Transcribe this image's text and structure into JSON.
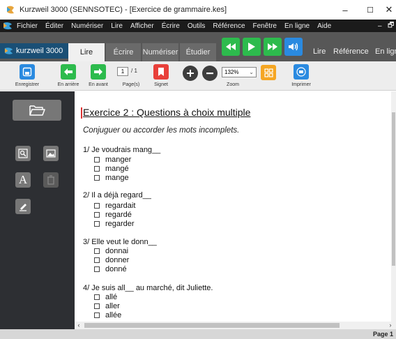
{
  "window": {
    "title": "Kurzweil 3000 (SENNSOTEC) - [Exercice de grammaire.kes]",
    "minimize": "–",
    "maximize": "☐",
    "close": "✕"
  },
  "menu": {
    "items": [
      "Fichier",
      "Éditer",
      "Numériser",
      "Lire",
      "Afficher",
      "Écrire",
      "Outils",
      "Référence",
      "Fenêtre",
      "En ligne",
      "Aide"
    ],
    "min_ctl": "–",
    "restore_ctl": "🗗"
  },
  "tabs": {
    "brand": "kurzweil 3000",
    "items": [
      "Lire",
      "Écrire",
      "Numériser",
      "Étudier"
    ],
    "active": "Lire",
    "right_items": [
      "Lire",
      "Référence",
      "En ligne"
    ]
  },
  "toolbar": {
    "save_label": "Enregistrer",
    "back_label": "En arrière",
    "forward_label": "En avant",
    "pages_label": "Page(s)",
    "bookmark_label": "Signet",
    "zoom_label": "Zoom",
    "print_label": "Imprimer",
    "current_page": "1",
    "total_pages": "/ 1",
    "zoom_value": "132%"
  },
  "document": {
    "title": "Exercice 2 : Questions à choix multiple",
    "subtitle": "Conjuguer ou accorder les mots incomplets.",
    "questions": [
      {
        "text": "1/  Je voudrais mang__",
        "options": [
          "manger",
          "mangé",
          "mange"
        ]
      },
      {
        "text": "2/  Il a déjà regard__",
        "options": [
          "regardait",
          "regardé",
          "regarder"
        ]
      },
      {
        "text": "3/  Elle veut le donn__",
        "options": [
          "donnai",
          "donner",
          "donné"
        ]
      },
      {
        "text": "4/  Je suis all__ au marché, dit Juliette.",
        "options": [
          "allé",
          "aller",
          "allée"
        ]
      }
    ]
  },
  "scroll": {
    "left_arrow": "‹",
    "right_arrow": "›"
  },
  "status": {
    "page_indicator": "Page 1"
  },
  "colors": {
    "green": "#2dbb4d",
    "blue": "#2a8ae0",
    "red": "#e8403a",
    "orange": "#f5a623",
    "side_panel": "#2d2f33"
  }
}
